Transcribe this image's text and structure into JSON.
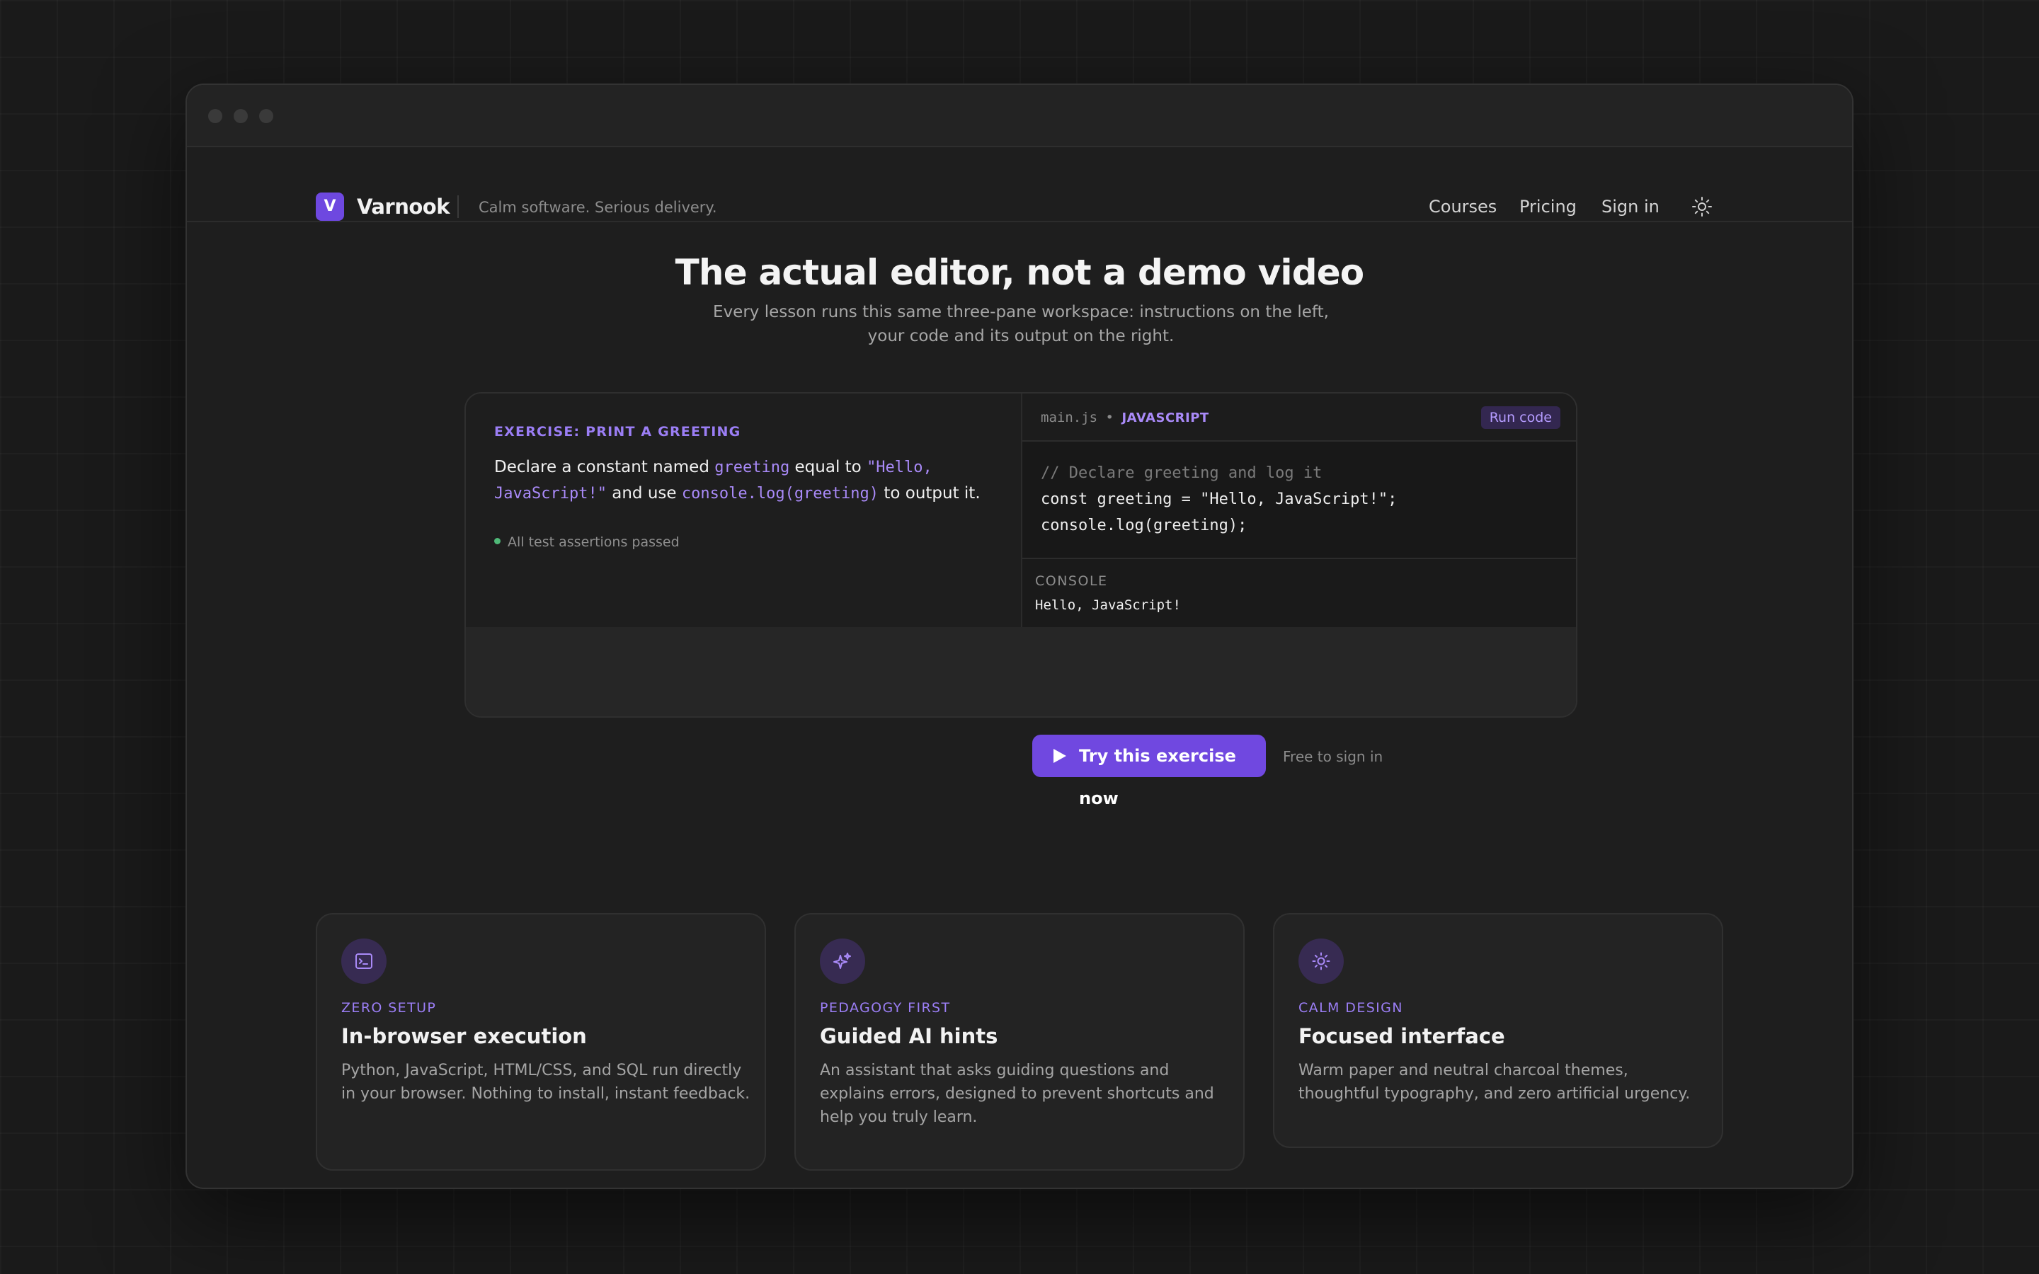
{
  "brand": {
    "logo_letter": "V",
    "name": "Varnook",
    "tagline": "Calm software. Serious delivery."
  },
  "nav": {
    "items": [
      "Courses",
      "Pricing",
      "Sign in"
    ],
    "theme_icon": "sun-icon"
  },
  "hero": {
    "title": "The actual editor, not a demo video",
    "subtitle": "Every lesson runs this same three-pane workspace: instructions on the left, your code and its output on the right."
  },
  "exercise": {
    "label": "EXERCISE: PRINT A GREETING",
    "desc_1": "Declare a constant named ",
    "code_1": "greeting",
    "desc_2": " equal to ",
    "code_2": "\"Hello, JavaScript!\"",
    "desc_3": " and use ",
    "code_3": "console.log(greeting)",
    "desc_4": " to output it.",
    "status": "All test assertions passed"
  },
  "editor": {
    "file": "main.js",
    "separator": "•",
    "language": "JAVASCRIPT",
    "run_label": "Run code",
    "code_comment": "// Declare greeting and log it",
    "code_line_2": "const greeting = \"Hello, JavaScript!\";",
    "code_line_3": "console.log(greeting);",
    "console_label": "CONSOLE",
    "console_output": "Hello, JavaScript!"
  },
  "cta": {
    "button": "Try this exercise now",
    "note": "Free to sign in"
  },
  "features": [
    {
      "icon": "terminal-icon",
      "kicker": "ZERO SETUP",
      "title": "In-browser execution",
      "desc": "Python, JavaScript, HTML/CSS, and SQL run directly in your browser. Nothing to install, instant feedback."
    },
    {
      "icon": "sparkles-icon",
      "kicker": "PEDAGOGY FIRST",
      "title": "Guided AI hints",
      "desc": "An assistant that asks guiding questions and explains errors, designed to prevent shortcuts and help you truly learn."
    },
    {
      "icon": "sun-icon",
      "kicker": "CALM DESIGN",
      "title": "Focused interface",
      "desc": "Warm paper and neutral charcoal themes, thoughtful typography, and zero artificial urgency."
    }
  ],
  "colors": {
    "accent": "#7048e0",
    "accent_text": "#a98af8",
    "success": "#4fb978",
    "background": "#1a1a1a"
  }
}
